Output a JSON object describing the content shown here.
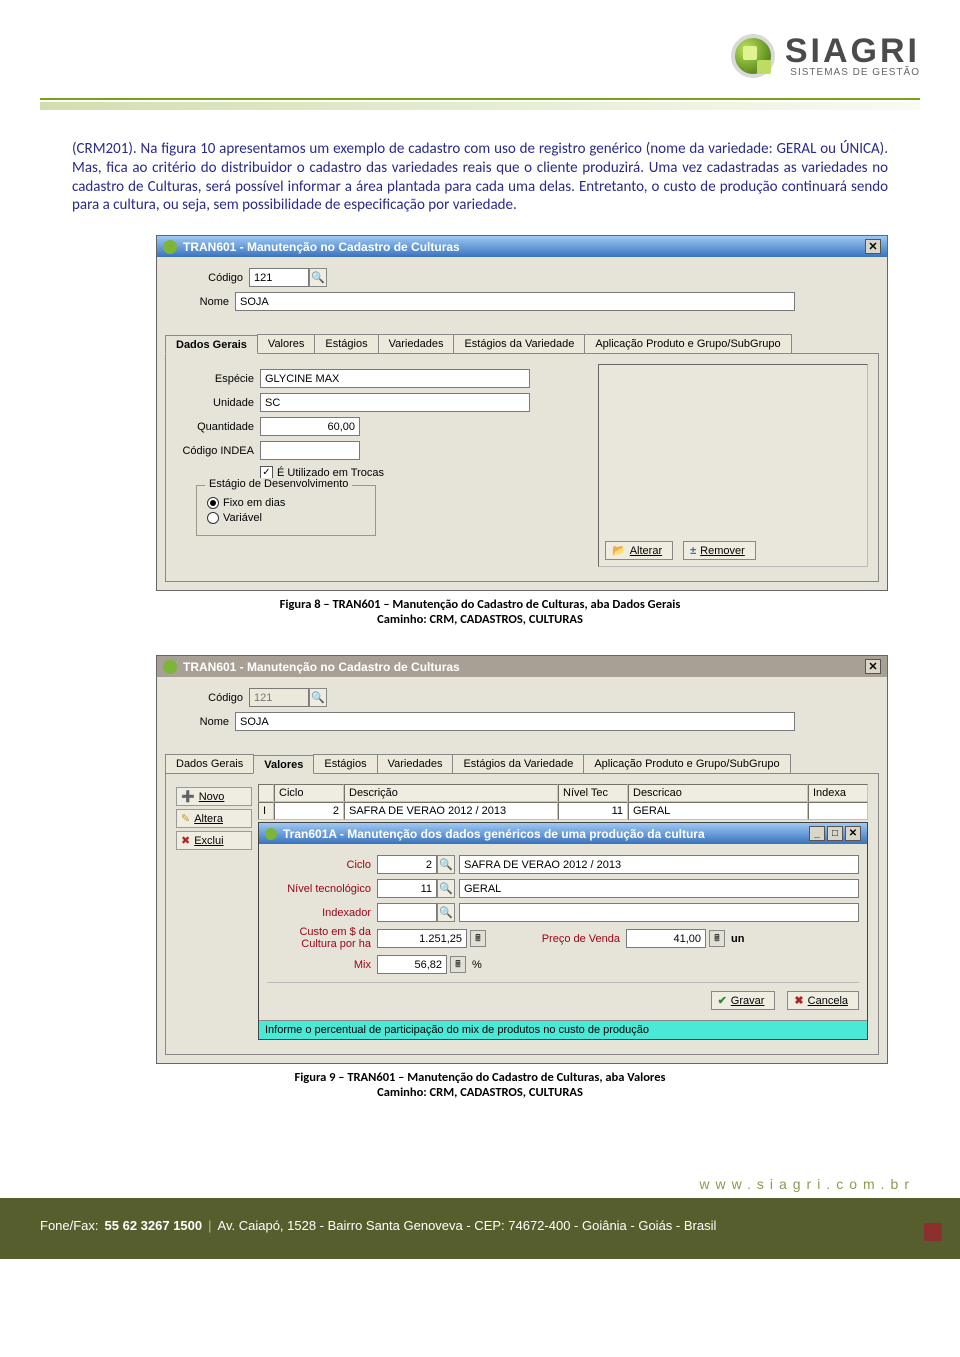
{
  "header": {
    "brand": "SIAGRI",
    "tagline": "SISTEMAS DE GESTÃO"
  },
  "paragraph": "(CRM201). Na figura 10 apresentamos um exemplo de cadastro com uso de registro genérico (nome da variedade: GERAL ou ÚNICA). Mas, fica ao critério do distribuidor o cadastro das variedades reais que o cliente produzirá. Uma vez cadastradas as variedades no cadastro de Culturas, será possível informar a área plantada para cada uma delas. Entretanto, o custo de produção continuará sendo para a cultura, ou seja, sem possibilidade de especificação por variedade.",
  "fig8": {
    "title": "TRAN601 - Manutenção no Cadastro de Culturas",
    "labels": {
      "codigo": "Código",
      "nome": "Nome",
      "especie": "Espécie",
      "unidade": "Unidade",
      "quantidade": "Quantidade",
      "codigo_indea": "Código INDEA",
      "utilizado_trocas": "É Utilizado em Trocas",
      "group_title": "Estágio de Desenvolvimento",
      "radio_fixo": "Fixo em dias",
      "radio_var": "Variável"
    },
    "values": {
      "codigo": "121",
      "nome": "SOJA",
      "especie": "GLYCINE MAX",
      "unidade": "SC",
      "quantidade": "60,00",
      "codigo_indea": ""
    },
    "tabs": [
      "Dados Gerais",
      "Valores",
      "Estágios",
      "Variedades",
      "Estágios da Variedade",
      "Aplicação Produto e Grupo/SubGrupo"
    ],
    "active_tab": 0,
    "buttons": {
      "alterar": "Alterar",
      "remover": "Remover"
    },
    "caption_title": "Figura 8 – TRAN601 – Manutenção do Cadastro de Culturas, aba Dados Gerais",
    "caption_sub": "Caminho: CRM, CADASTROS, CULTURAS"
  },
  "fig9": {
    "title": "TRAN601 - Manutenção no Cadastro de Culturas",
    "values": {
      "codigo": "121",
      "nome": "SOJA"
    },
    "tabs": [
      "Dados Gerais",
      "Valores",
      "Estágios",
      "Variedades",
      "Estágios da Variedade",
      "Aplicação Produto e Grupo/SubGrupo"
    ],
    "active_tab": 1,
    "toolbar": {
      "novo": "Novo",
      "altera": "Altera",
      "exclui": "Exclui"
    },
    "grid": {
      "headers": {
        "ciclo": "Ciclo",
        "descricao": "Descrição",
        "niveltec": "Nível Tec",
        "descricao2": "Descricao",
        "index": "Indexa"
      },
      "row": {
        "ciclo": "2",
        "descricao": "SAFRA DE VERAO 2012 / 2013",
        "niveltec": "11",
        "descricao2": "GERAL",
        "index": ""
      }
    },
    "subwin": {
      "title": "Tran601A - Manutenção dos dados genéricos de uma produção da cultura",
      "labels": {
        "ciclo": "Ciclo",
        "nivel": "Nível tecnológico",
        "indexador": "Indexador",
        "custo": "Custo em $ da Cultura por ha",
        "preco": "Preço de Venda",
        "mix": "Mix",
        "un": "un",
        "pct": "%"
      },
      "values": {
        "ciclo": "2",
        "ciclo_desc": "SAFRA DE VERAO 2012 / 2013",
        "nivel": "11",
        "nivel_desc": "GERAL",
        "indexador": "",
        "custo": "1.251,25",
        "preco": "41,00",
        "mix": "56,82"
      },
      "buttons": {
        "gravar": "Gravar",
        "cancela": "Cancela"
      },
      "status": "Informe o percentual de participação do mix de produtos no custo de produção"
    },
    "caption_title": "Figura 9 – TRAN601 – Manutenção do Cadastro de Culturas, aba Valores",
    "caption_sub": "Caminho: CRM, CADASTROS, CULTURAS"
  },
  "footer": {
    "site": "www.siagri.com.br",
    "phone_label": "Fone/Fax:",
    "phone": "55 62 3267 1500",
    "addr": "Av. Caiapó, 1528 - Bairro Santa Genoveva - CEP: 74672-400 - Goiânia - Goiás - Brasil"
  }
}
